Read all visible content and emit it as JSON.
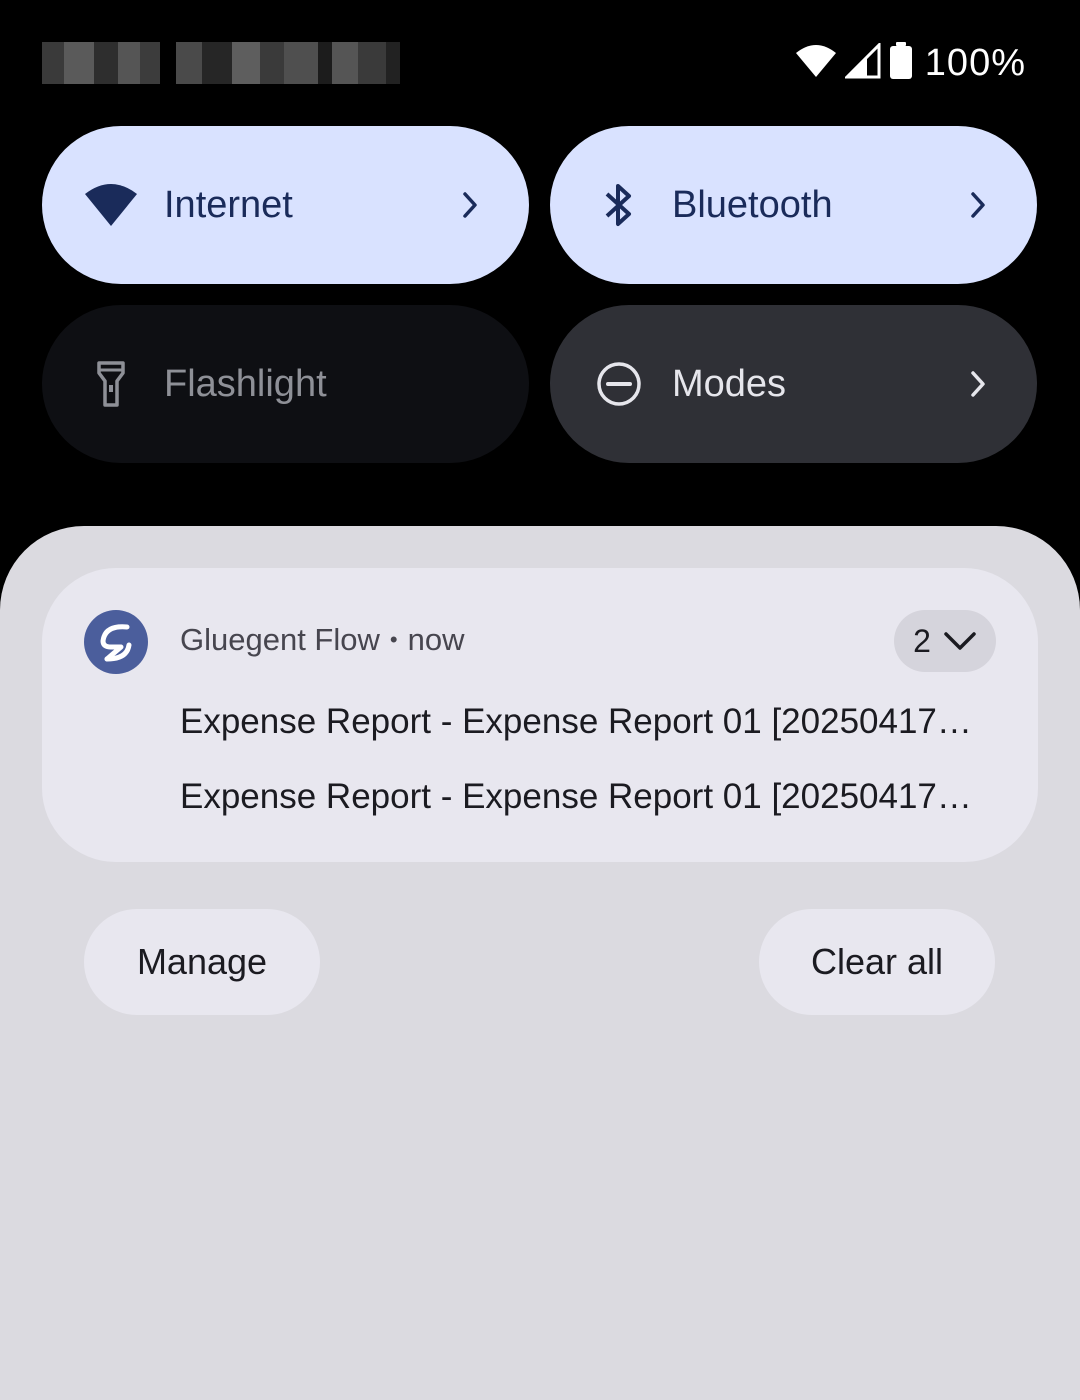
{
  "status_bar": {
    "battery_text": "100%",
    "icons": [
      "wifi-icon",
      "cell-signal-icon",
      "battery-icon"
    ]
  },
  "quick_settings": {
    "tiles": [
      {
        "label": "Internet",
        "icon": "wifi-icon",
        "state": "on",
        "has_chevron": true
      },
      {
        "label": "Bluetooth",
        "icon": "bluetooth-icon",
        "state": "on",
        "has_chevron": true
      },
      {
        "label": "Flashlight",
        "icon": "flashlight-icon",
        "state": "off",
        "has_chevron": false
      },
      {
        "label": "Modes",
        "icon": "do-not-disturb-icon",
        "state": "neutral",
        "has_chevron": true
      }
    ]
  },
  "notification": {
    "app_name": "Gluegent Flow",
    "separator": "•",
    "time": "now",
    "count": "2",
    "lines": [
      "Expense Report - Expense Report 01 [20250417…",
      "Expense Report - Expense Report 01 [20250417…"
    ]
  },
  "actions": {
    "manage_label": "Manage",
    "clear_all_label": "Clear all"
  },
  "colors": {
    "tile_active_bg": "#d9e2ff",
    "tile_active_fg": "#1a2b5a",
    "tile_off_bg": "#0e0f13",
    "tile_dark_bg": "#2f3036",
    "shade_bg": "#dbdae0",
    "card_bg": "#e8e7ef",
    "app_icon_bg": "#4b5e9c"
  }
}
